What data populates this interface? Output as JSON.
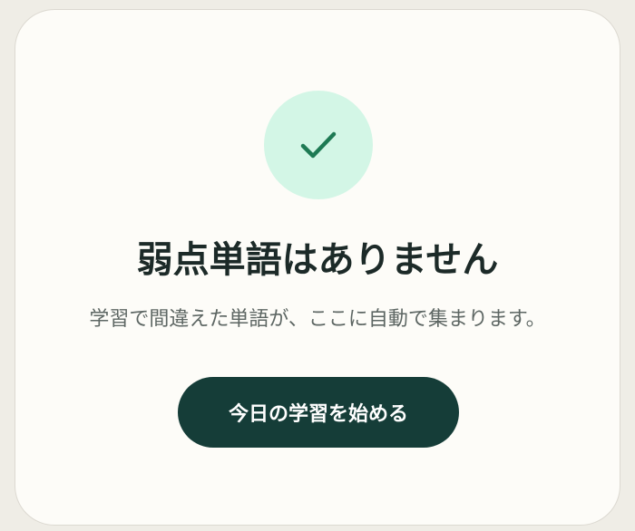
{
  "empty_state": {
    "title": "弱点単語はありません",
    "message": "学習で間違えた単語が、ここに自動で集まります。",
    "icon": "check-icon",
    "start_button_label": "今日の学習を始める"
  },
  "colors": {
    "page_background": "#efede6",
    "card_background": "#fdfcf8",
    "icon_circle": "#d3f6e6",
    "icon_stroke": "#1e7a54",
    "title_text": "#1c2a28",
    "message_text": "#5d6663",
    "button_background": "#153d38",
    "button_text": "#ffffff"
  }
}
